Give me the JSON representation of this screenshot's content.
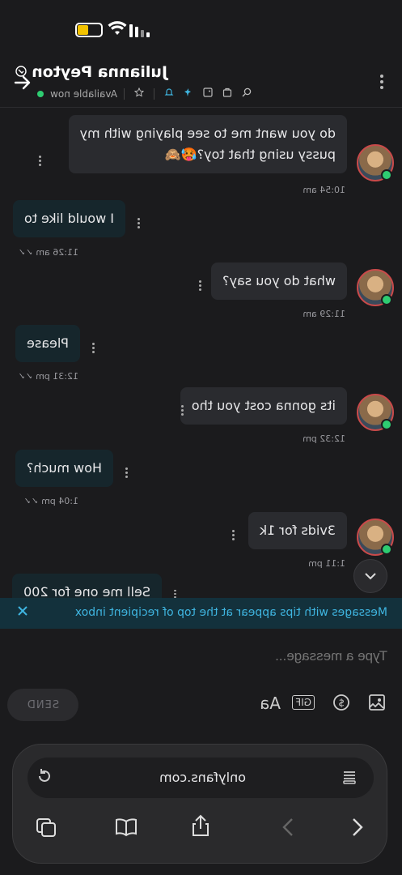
{
  "status_bar": {
    "time": ""
  },
  "header": {
    "contact_name": "Julianna Peyton",
    "status_text": "Available now"
  },
  "messages": [
    {
      "dir": "out",
      "text_lines": [
        "do you want me to see playing with my",
        "pussy using that toy?🥵🙈"
      ],
      "time": "10:54 am"
    },
    {
      "dir": "in",
      "text_lines": [
        "I would like to"
      ],
      "time": "11:26 am"
    },
    {
      "dir": "out",
      "text_lines": [
        "what do you say?"
      ],
      "time": "11:29 am"
    },
    {
      "dir": "in",
      "text_lines": [
        "Please"
      ],
      "time": "12:31 pm"
    },
    {
      "dir": "out",
      "text_lines": [
        "its gonna cost you tho"
      ],
      "time": "12:32 pm"
    },
    {
      "dir": "in",
      "text_lines": [
        "How much?"
      ],
      "time": "1:04 pm"
    },
    {
      "dir": "out",
      "text_lines": [
        "3vids for 1k"
      ],
      "time": "1:11 pm"
    },
    {
      "dir": "in",
      "text_lines": [
        "Sell me one for 200"
      ],
      "time": ""
    }
  ],
  "tips_banner": {
    "text": "Messages with tips appear at the top of recipient inbox"
  },
  "composer": {
    "placeholder": "Type a message...",
    "send_label": "SEND",
    "font_label": "Aa",
    "gif_label": "GIF"
  },
  "browser": {
    "url": "onlyfans.com"
  },
  "icons": {
    "verified": "verified-icon",
    "back": "arrow-back-icon",
    "more": "more-vert-icon",
    "star": "star-icon",
    "bell": "bell-icon",
    "pin": "pin-icon",
    "gallery": "gallery-icon",
    "vault": "vault-icon",
    "search": "search-icon"
  },
  "colors": {
    "accent": "#3fb5e0",
    "online": "#2ecc71",
    "battery": "#f2c200"
  }
}
